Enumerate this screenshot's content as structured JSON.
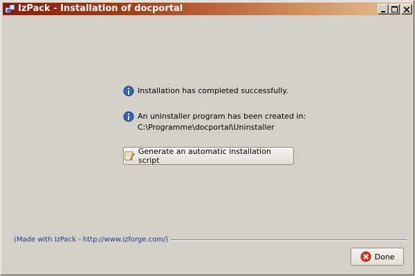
{
  "window": {
    "title": "IzPack - Installation of docportal",
    "controls": [
      "minimize-icon",
      "maximize-icon",
      "close-icon"
    ]
  },
  "messages": [
    {
      "icon": "info-icon",
      "text": "Installation has completed successfully."
    },
    {
      "icon": "info-icon",
      "text": "An uninstaller program has been created in:",
      "subtext": "C:\\Programme\\docportal\\Uninstaller"
    }
  ],
  "generate_button": {
    "icon": "pencil-icon",
    "label": "Generate an automatic installation script"
  },
  "footer": {
    "text": "(Made with IzPack - http://www.izforge.com/)"
  },
  "done_button": {
    "icon": "cancel-icon",
    "label": "Done"
  },
  "colors": {
    "titlebar_start": "#8a1a08",
    "titlebar_end": "#e8c49a",
    "footer_link": "#1c3a9a",
    "background": "#d4d0c8"
  }
}
